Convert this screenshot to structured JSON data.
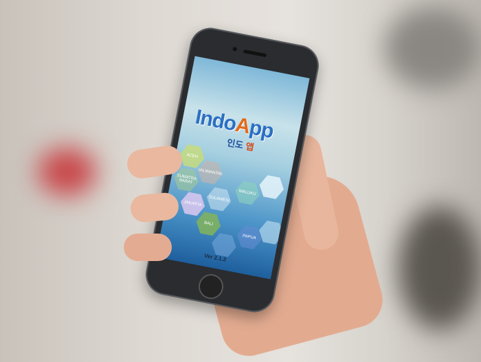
{
  "app": {
    "logo_text": "IndoApp",
    "logo_korean": "인도 앱",
    "version": "Ver 2.1.2"
  },
  "regions": [
    "ACEH",
    "KALIMANTAN",
    "SUMATRA BARAT",
    "MALUKU",
    "JAKARTA",
    "SULAWESI",
    "BALI",
    "PAPUA"
  ],
  "colors": {
    "logo_blue": "#2c6fc2",
    "logo_orange": "#e36a1b"
  }
}
